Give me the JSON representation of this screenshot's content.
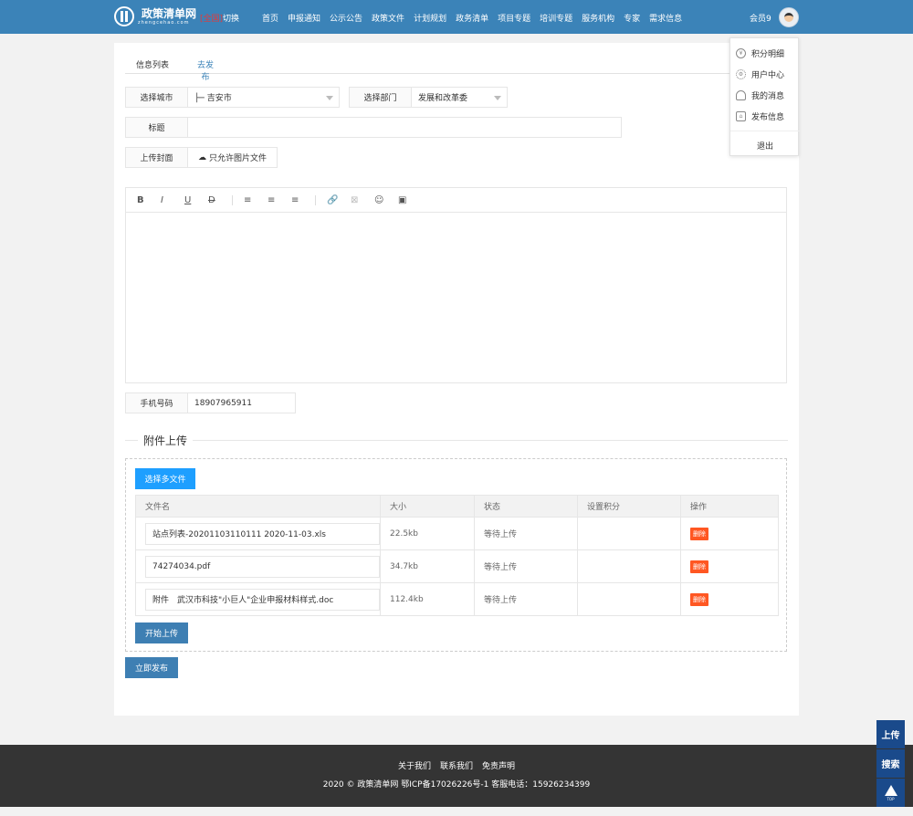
{
  "brand": {
    "name": "政策清单网",
    "sub": "zhengcehao.com",
    "region_tag": "[全国]",
    "region_switch": "切换"
  },
  "nav": [
    "首页",
    "申报通知",
    "公示公告",
    "政策文件",
    "计划规划",
    "政务清单",
    "项目专题",
    "培训专题",
    "服务机构",
    "专家",
    "需求信息"
  ],
  "user": {
    "name": "会员9"
  },
  "dropdown": {
    "items": [
      {
        "label": "积分明细",
        "icon": "yen-icon"
      },
      {
        "label": "用户中心",
        "icon": "gear-icon"
      },
      {
        "label": "我的消息",
        "icon": "bell-icon"
      },
      {
        "label": "发布信息",
        "icon": "home-icon"
      }
    ],
    "logout": "退出"
  },
  "tabs": [
    "信息列表",
    "去发布"
  ],
  "form": {
    "city_label": "选择城市",
    "city_value": "├─ 吉安市",
    "dept_label": "选择部门",
    "dept_value": "发展和改革委",
    "title_label": "标题",
    "title_value": "",
    "cover_label": "上传封面",
    "cover_button": "只允许图片文件",
    "phone_label": "手机号码",
    "phone_value": "18907965911"
  },
  "editor_tools": [
    "B",
    "I",
    "U",
    "D",
    "≡",
    "≡",
    "≡",
    "🔗",
    "⊠",
    "☺",
    "▣"
  ],
  "attachments": {
    "section_title": "附件上传",
    "select_button": "选择多文件",
    "columns": [
      "文件名",
      "大小",
      "状态",
      "设置积分",
      "操作"
    ],
    "rows": [
      {
        "name": "站点列表-20201103110111 2020-11-03.xls",
        "size": "22.5kb",
        "status": "等待上传",
        "points": "",
        "action": "删除"
      },
      {
        "name": "74274034.pdf",
        "size": "34.7kb",
        "status": "等待上传",
        "points": "",
        "action": "删除"
      },
      {
        "name": "附件　武汉市科技\"小巨人\"企业申报材料样式.doc",
        "size": "112.4kb",
        "status": "等待上传",
        "points": "",
        "action": "删除"
      }
    ],
    "start_button": "开始上传"
  },
  "publish_button": "立即发布",
  "footer": {
    "links": [
      "关于我们",
      "联系我们",
      "免责声明"
    ],
    "copyright": "2020 © 政策清单网 鄂ICP备17026226号-1 客服电话：15926234399"
  },
  "side": {
    "upload": "上传",
    "search": "搜索",
    "top": "TOP"
  }
}
